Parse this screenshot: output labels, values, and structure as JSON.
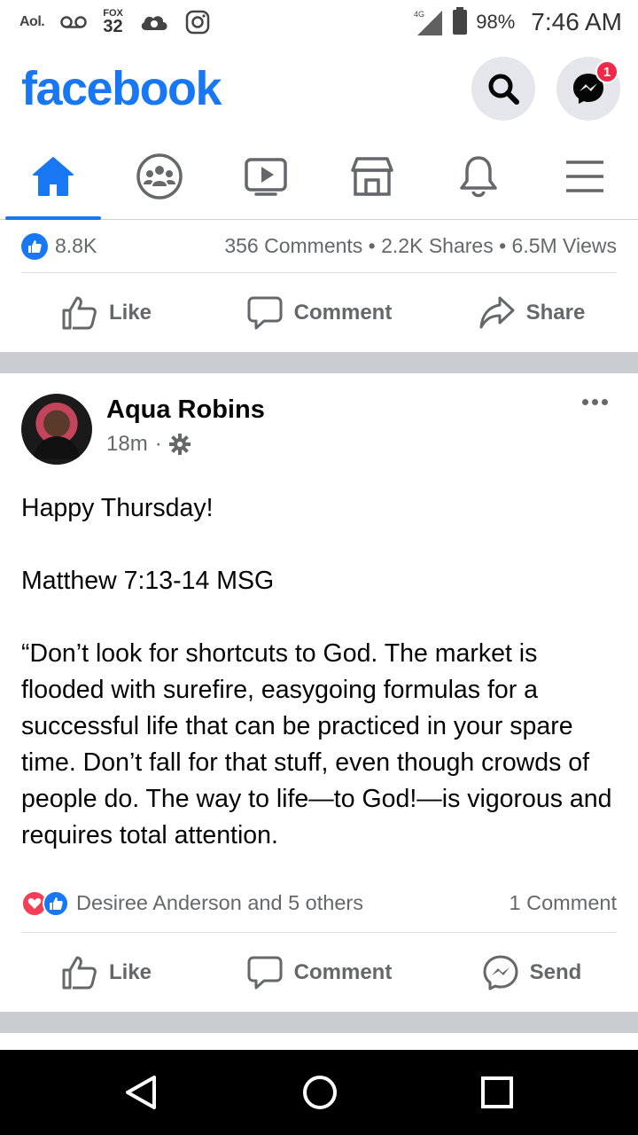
{
  "status_bar": {
    "left_icons": [
      "aol-icon",
      "voicemail-icon",
      "fox32-icon",
      "cloud-icon",
      "instagram-icon"
    ],
    "aol_label": "Aol.",
    "fox_label": "FOX",
    "fox_number": "32",
    "network_label": "4G LTE",
    "battery_percent": "98%",
    "time": "7:46 AM"
  },
  "header": {
    "logo": "facebook",
    "messenger_badge": "1"
  },
  "nav_tabs": [
    {
      "name": "home",
      "active": true
    },
    {
      "name": "groups",
      "active": false
    },
    {
      "name": "watch",
      "active": false
    },
    {
      "name": "marketplace",
      "active": false
    },
    {
      "name": "notifications",
      "active": false
    },
    {
      "name": "menu",
      "active": false
    }
  ],
  "previous_post": {
    "reaction_count": "8.8K",
    "engagement": "356 Comments • 2.2K Shares • 6.5M Views",
    "actions": {
      "like": "Like",
      "comment": "Comment",
      "share": "Share"
    }
  },
  "post": {
    "author": "Aqua Robins",
    "time": "18m",
    "body": [
      "Happy Thursday!",
      "",
      "Matthew 7:13-14 MSG",
      "",
      "“Don’t look for shortcuts to God. The market is flooded with surefire, easygoing formulas for a successful life that can be practiced in your spare time. Don’t fall for that stuff, even though crowds of people do. The way to life—to God!—is vigorous and requires total attention."
    ],
    "reactions_text": "Desiree Anderson and 5 others",
    "comments_text": "1 Comment",
    "actions": {
      "like": "Like",
      "comment": "Comment",
      "send": "Send"
    }
  },
  "colors": {
    "brand": "#1877f2",
    "badge": "#f02849",
    "love": "#f33e58",
    "secondary_text": "#65676b",
    "divider_band": "#c9ccd1"
  }
}
